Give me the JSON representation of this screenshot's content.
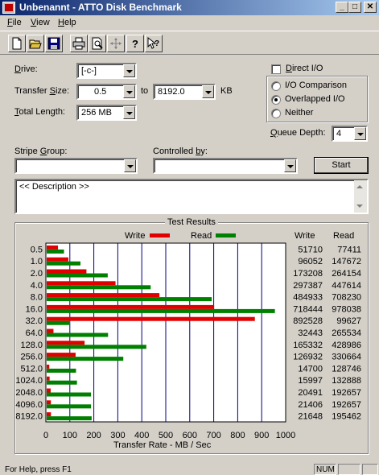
{
  "window": {
    "title": "Unbenannt - ATTO Disk Benchmark",
    "minimize": "_",
    "maximize": "□",
    "close": "✕"
  },
  "menu": [
    {
      "label": "File",
      "underline": "F",
      "rest": "ile"
    },
    {
      "label": "View",
      "underline": "V",
      "rest": "iew"
    },
    {
      "label": "Help",
      "underline": "H",
      "rest": "elp"
    }
  ],
  "toolbar": [
    "new-icon",
    "open-icon",
    "save-icon",
    "print-icon",
    "print-preview-icon",
    "move-icon",
    "help-icon",
    "context-help-icon"
  ],
  "form": {
    "drive_label": "Drive:",
    "drive_value": "[-c-]",
    "transfer_size_label": "Transfer Size:",
    "transfer_from": "0.5",
    "to_label": "to",
    "transfer_to": "8192.0",
    "kb_label": "KB",
    "total_length_label": "Total Length:",
    "total_length_value": "256 MB",
    "direct_io_label": "Direct I/O",
    "direct_io_checked": false,
    "io_options": [
      {
        "label": "I/O Comparison",
        "selected": false
      },
      {
        "label": "Overlapped I/O",
        "selected": true
      },
      {
        "label": "Neither",
        "selected": false
      }
    ],
    "queue_depth_label": "Queue Depth:",
    "queue_depth_value": "4",
    "stripe_group_label": "Stripe Group:",
    "stripe_group_value": "",
    "controlled_by_label": "Controlled by:",
    "controlled_by_value": "",
    "start_label": "Start",
    "description": "<< Description >>"
  },
  "results": {
    "group_title": "Test Results",
    "legend_write": "Write",
    "legend_read": "Read",
    "col_write": "Write",
    "col_read": "Read",
    "colors": {
      "write": "#e00000",
      "read": "#008000",
      "plot_bg": "#ffffff",
      "grid": "#000080"
    }
  },
  "chart_data": {
    "type": "bar",
    "orientation": "horizontal",
    "categories": [
      "0.5",
      "1.0",
      "2.0",
      "4.0",
      "8.0",
      "16.0",
      "32.0",
      "64.0",
      "128.0",
      "256.0",
      "512.0",
      "1024.0",
      "2048.0",
      "4096.0",
      "8192.0"
    ],
    "series": [
      {
        "name": "Write",
        "values": [
          51710,
          96052,
          173208,
          297387,
          484933,
          718444,
          892528,
          32443,
          165332,
          126932,
          14700,
          15997,
          20491,
          21406,
          21648
        ]
      },
      {
        "name": "Read",
        "values": [
          77411,
          147672,
          264154,
          447614,
          708230,
          978038,
          99627,
          265534,
          428986,
          330664,
          128746,
          132888,
          192657,
          192657,
          195462
        ]
      }
    ],
    "xlabel": "Transfer Rate - MB / Sec",
    "xlim": [
      0,
      1000
    ],
    "xticks": [
      "0",
      "100",
      "200",
      "300",
      "400",
      "500",
      "600",
      "700",
      "800",
      "900",
      "1000"
    ],
    "grid": true,
    "legend_position": "top"
  },
  "status": {
    "text": "For Help, press F1",
    "num": "NUM"
  }
}
